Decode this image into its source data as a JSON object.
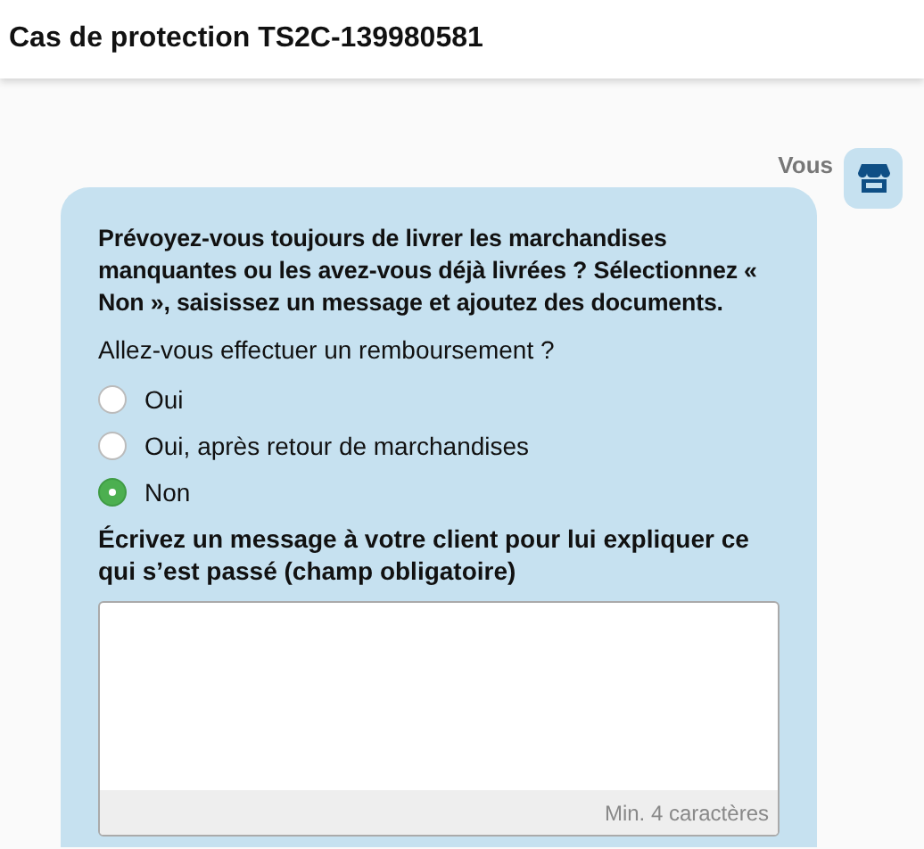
{
  "header": {
    "title": "Cas de protection TS2C-139980581"
  },
  "message": {
    "sender": "Vous",
    "prompt": "Prévoyez-vous toujours de livrer les marchandises manquantes ou les avez-vous déjà livrées ? Sélectionnez « Non », saisissez un message et ajoutez des documents.",
    "question": "Allez-vous effectuer un remboursement ?",
    "options": [
      {
        "label": "Oui",
        "selected": false
      },
      {
        "label": "Oui, après retour de marchandises",
        "selected": false
      },
      {
        "label": "Non",
        "selected": true
      }
    ],
    "message_label": "Écrivez un message à votre client pour lui expliquer ce qui s’est passé (champ obligatoire)",
    "counter_hint": "Min. 4 caractères"
  }
}
